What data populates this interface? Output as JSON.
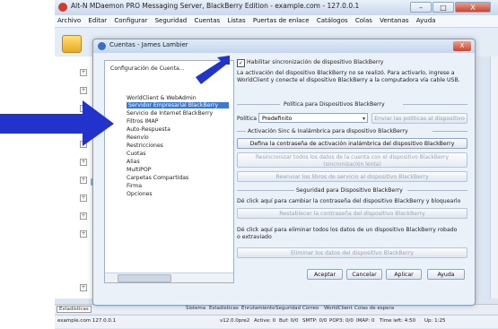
{
  "main_window": {
    "title": "Alt-N MDaemon PRO Messaging Server, BlackBerry Edition - example.com - 127.0.0.1",
    "minimize": "–",
    "maximize": "□",
    "close": "X",
    "menu": [
      "Archivo",
      "Editar",
      "Configurar",
      "Seguridad",
      "Cuentas",
      "Listas",
      "Puertas de enlace",
      "Catálogos",
      "Colas",
      "Ventanas",
      "Ayuda"
    ]
  },
  "bottom_tabs": [
    "Estadísticas",
    "Sistema",
    "Estadísticas",
    "Enrutamiento",
    "Seguridad",
    "Correo",
    "WorldClient",
    "Colas de espera"
  ],
  "statusbar": {
    "server": "example.com 127.0.0.1",
    "version": "v12.0.0pre2",
    "active": "Active: 0",
    "buf": "Buf: 0/0",
    "smtp": "SMTP: 0/0",
    "pop3": "POP3: 0/0",
    "imap": "IMAP: 0",
    "timeleft": "Time left: 4:50",
    "uptime": "Up: 1:25"
  },
  "dialog": {
    "title": "Cuentas - James Lambier",
    "close": "X",
    "nav": {
      "root": "Configuración de Cuenta...",
      "items": [
        "WorldClient & WebAdmin",
        "Servidor Empresarial BlackBerry",
        "Servicio de Internet BlackBerry",
        "Filtros IMAP",
        "Auto-Respuesta",
        "Reenvío",
        "Restricciones",
        "Cuotas",
        "Alias",
        "MultiPOP",
        "Carpetas Compartidas",
        "Firma",
        "Opciones"
      ],
      "selected_index": 1
    },
    "enable_checkbox": {
      "label": "Habilitar sincronización de dispositivo BlackBerry",
      "checked": true
    },
    "activation_info": "La activación del dispositivo BlackBerry no se realizó. Para activarlo, ingrese a WorldClient y conecte el dispositivo BlackBerry a la computadora vía cable USB.",
    "policy_section": "Política para Dispositivos BlackBerry",
    "policy_label": "Política",
    "policy_value": "Predefinito",
    "send_policy_button": "Enviar las políticas al dispositivo",
    "activation_section": "Activación Sinc & Inalámbrica para dispositivo BlackBerry",
    "set_password_button": "Defina la contraseña de activación inalámbrica del dispositivo BlackBerry",
    "resync_button_line1": "Resincronizar todos los datos de la cuenta con el dispositivo BlackBerry",
    "resync_button_line2": "(sincronización lenta)",
    "resend_button": "Reenviar los libros de servicio al dispositivo BlackBerry",
    "security_section": "Seguridad para Dispositivo BlackBerry",
    "change_password_text": "Dé click aquí para cambiar la contraseña del dispositivo BlackBerry y bloquearlo",
    "reset_password_button": "Restablecer la contraseña del dispositivo BlackBerry",
    "wipe_text": "Dé click aquí para eliminar todos los datos de un dispositivo BlackBerry robado o extraviado",
    "wipe_button": "Eliminar los datos del dispositivo BlackBerry",
    "footer": {
      "accept": "Aceptar",
      "cancel": "Cancelar",
      "apply": "Aplicar",
      "help": "Ayuda"
    }
  },
  "colors": {
    "arrow": "#2233cc",
    "selection": "#3b78d8"
  }
}
